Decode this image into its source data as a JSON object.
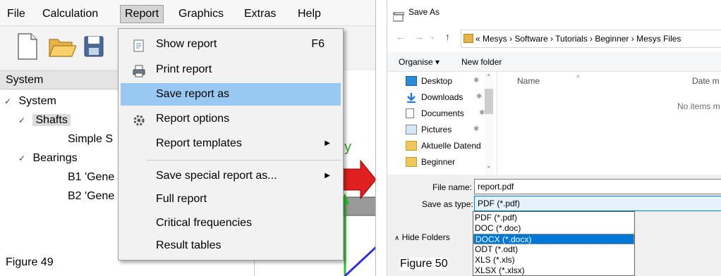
{
  "left": {
    "menubar": [
      "File",
      "Calculation",
      "Report",
      "Graphics",
      "Extras",
      "Help"
    ],
    "system_header": "System",
    "tree": {
      "root": "System",
      "shafts": "Shafts",
      "shaft_child": "Simple S",
      "bearings": "Bearings",
      "bearing_1": "B1 'Gene",
      "bearing_2": "B2 'Gene"
    },
    "canvas_label": "y",
    "menu": {
      "show_report": "Show report",
      "show_report_shortcut": "F6",
      "print_report": "Print report",
      "save_report_as": "Save report as",
      "report_options": "Report options",
      "report_templates": "Report templates",
      "save_special": "Save special report as...",
      "full_report": "Full report",
      "critical_frequencies": "Critical frequencies",
      "result_tables": "Result tables"
    },
    "figure_label": "Figure 49"
  },
  "right": {
    "title": "Save As",
    "breadcrumb": "« Mesys › Software › Tutorials › Beginner › Mesys Files",
    "organise": "Organise ▾",
    "new_folder": "New folder",
    "nav_items": [
      "Desktop",
      "Downloads",
      "Documents",
      "Pictures",
      "Aktuelle Datend",
      "Beginner"
    ],
    "column_name": "Name",
    "column_date": "Date m",
    "empty_text": "No items m",
    "file_name_label": "File name:",
    "file_name_value": "report.pdf",
    "save_type_label": "Save as type:",
    "save_type_value": "PDF (*.pdf)",
    "type_options": [
      "PDF (*.pdf)",
      "DOC (*.doc)",
      "DOCX (*.docx)",
      "ODT (*.odt)",
      "XLS (*.xls)",
      "XLSX (*.xlsx)"
    ],
    "selected_option_index": 2,
    "hide_folders": "Hide Folders",
    "figure_label": "Figure 50"
  }
}
